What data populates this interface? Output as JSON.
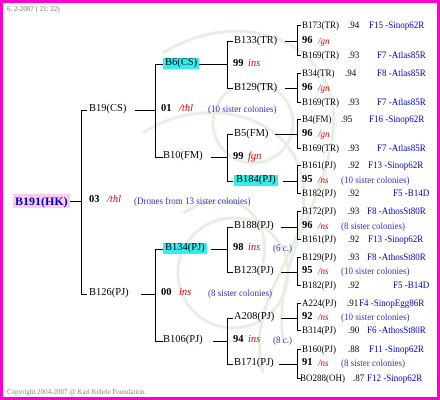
{
  "header": {
    "date": "6.  2-2007 ( 21: 22)"
  },
  "footer": {
    "copyright": "Copyright 2004-2007 @ Karl Kehrle Foundation."
  },
  "colors": {
    "border": "#ff00cc",
    "highlight": "#33eeee",
    "root_bg": "#ffccee",
    "accent_red": "#dd0000",
    "accent_blue": "#0000cc"
  },
  "root": {
    "id": "B191(HK)",
    "year": "03",
    "label": "/thl",
    "note": "(Drones from 13 sister colonies)"
  },
  "gen1": {
    "top": {
      "id": "B19(CS)",
      "year": "01",
      "label": "/thl",
      "note": "(10 sister colonies)"
    },
    "bottom": {
      "id": "B126(PJ)",
      "year": "00",
      "label": "ins",
      "note": "(8 sister colonies)"
    }
  },
  "gen2": {
    "a": {
      "id": "B6(CS)",
      "year": "99",
      "label": "ins"
    },
    "b": {
      "id": "B10(FM)",
      "year": "99",
      "label": "fgn"
    },
    "c": {
      "id": "B134(PJ)",
      "year": "98",
      "label": "ins",
      "note": "(6 c.)"
    },
    "d": {
      "id": "B106(PJ)",
      "year": "94",
      "label": "ins",
      "note": "(8 c.)"
    }
  },
  "gen3": {
    "a": {
      "id": "B133(TR)",
      "year": "96",
      "label": "/gn"
    },
    "b": {
      "id": "B129(TR)",
      "year": "96",
      "label": "/gn"
    },
    "c": {
      "id": "B5(FM)",
      "year": "96",
      "label": "/gn"
    },
    "d": {
      "id": "B184(PJ)",
      "year": "95",
      "label": "/ns",
      "note": "(10 sister colonies)"
    },
    "e": {
      "id": "B188(PJ)",
      "year": "96",
      "label": "/ns",
      "note": "(8 sister colonies)"
    },
    "f": {
      "id": "B123(PJ)",
      "year": "95",
      "label": "/ns",
      "note": "(10 sister colonies)"
    },
    "g": {
      "id": "A208(PJ)",
      "year": "92",
      "label": "/ns",
      "note": "(10 sister colonies)"
    },
    "h": {
      "id": "B171(PJ)",
      "year": "91",
      "label": "/ns",
      "note": "(8 sister colonies)"
    }
  },
  "gen4": [
    {
      "id": "B173(TR)",
      "val": ".94",
      "code": "F15 -Sinop62R"
    },
    {
      "id": "B169(TR)",
      "val": ".93",
      "code": "F7 -Atlas85R"
    },
    {
      "id": "B34(TR)",
      "val": ".94",
      "code": "F8 -Atlas85R"
    },
    {
      "id": "B169(TR)",
      "val": ".93",
      "code": "F7 -Atlas85R"
    },
    {
      "id": "B4(FM)",
      "val": ".95",
      "code": "F16 -Sinop62R"
    },
    {
      "id": "B169(TR)",
      "val": ".93",
      "code": "F7 -Atlas85R"
    },
    {
      "id": "B161(PJ)",
      "val": ".92",
      "code": "F13 -Sinop62R"
    },
    {
      "id": "B182(PJ)",
      "val": ".92",
      "code": "F5 -B14D"
    },
    {
      "id": "B172(PJ)",
      "val": ".93",
      "code": "F8 -AthosSt80R"
    },
    {
      "id": "B161(PJ)",
      "val": ".92",
      "code": "F13 -Sinop62R"
    },
    {
      "id": "B129(PJ)",
      "val": ".93",
      "code": "F8 -AthosSt80R"
    },
    {
      "id": "B182(PJ)",
      "val": ".92",
      "code": "F5 -B14D"
    },
    {
      "id": "A224(PJ)",
      "val": ".91",
      "code": "F4 -SinopEgg86R"
    },
    {
      "id": "B314(PJ)",
      "val": ".90",
      "code": "F6 -AthosSt80R"
    },
    {
      "id": "B160(PJ)",
      "val": ".88",
      "code": "F11 -Sinop62R"
    },
    {
      "id": "BO288(OH)",
      "val": ".87",
      "code": "F12 -Sinop62R"
    }
  ]
}
